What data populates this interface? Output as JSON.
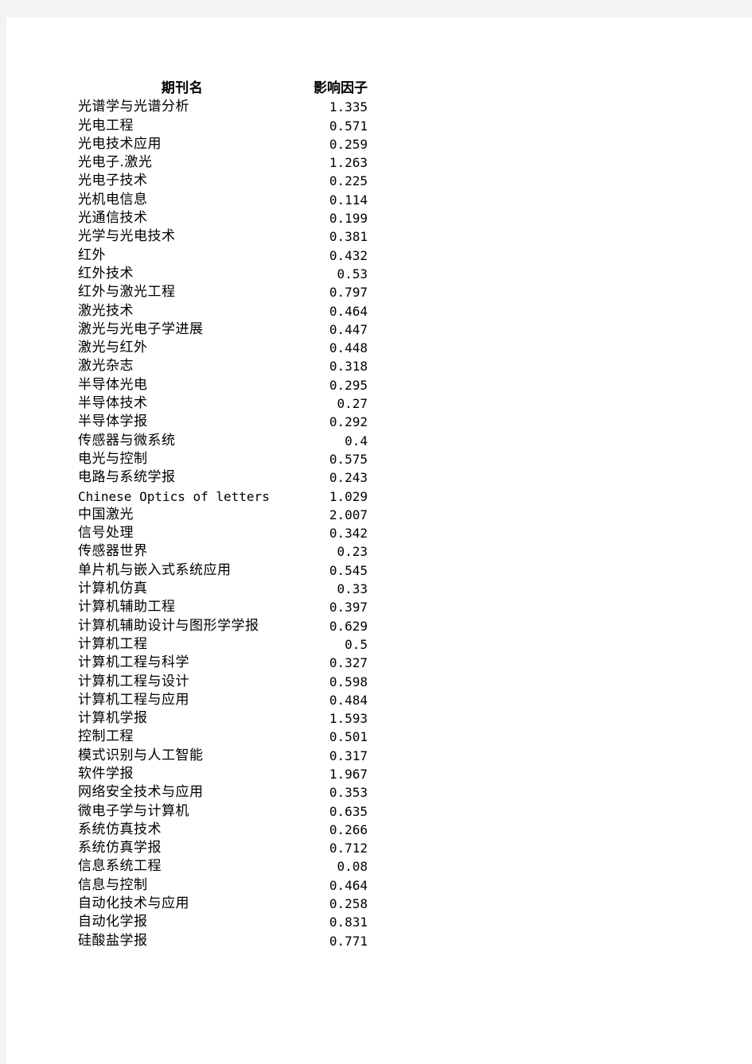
{
  "table": {
    "headers": {
      "name": "期刊名",
      "impact_factor": "影响因子"
    },
    "rows": [
      {
        "name": "光谱学与光谱分析",
        "value": "1.335"
      },
      {
        "name": "光电工程",
        "value": "0.571"
      },
      {
        "name": "光电技术应用",
        "value": "0.259"
      },
      {
        "name": "光电子.激光",
        "value": "1.263"
      },
      {
        "name": "光电子技术",
        "value": "0.225"
      },
      {
        "name": "光机电信息",
        "value": "0.114"
      },
      {
        "name": "光通信技术",
        "value": "0.199"
      },
      {
        "name": "光学与光电技术",
        "value": "0.381"
      },
      {
        "name": "红外",
        "value": "0.432"
      },
      {
        "name": "红外技术",
        "value": "0.53"
      },
      {
        "name": "红外与激光工程",
        "value": "0.797"
      },
      {
        "name": "激光技术",
        "value": "0.464"
      },
      {
        "name": "激光与光电子学进展",
        "value": "0.447"
      },
      {
        "name": "激光与红外",
        "value": "0.448"
      },
      {
        "name": "激光杂志",
        "value": "0.318"
      },
      {
        "name": "半导体光电",
        "value": "0.295"
      },
      {
        "name": "半导体技术",
        "value": "0.27"
      },
      {
        "name": "半导体学报",
        "value": "0.292"
      },
      {
        "name": "传感器与微系统",
        "value": "0.4"
      },
      {
        "name": "电光与控制",
        "value": "0.575"
      },
      {
        "name": "电路与系统学报",
        "value": "0.243"
      },
      {
        "name": "Chinese Optics of letters",
        "value": "1.029"
      },
      {
        "name": "中国激光",
        "value": "2.007"
      },
      {
        "name": "信号处理",
        "value": "0.342"
      },
      {
        "name": "传感器世界",
        "value": "0.23"
      },
      {
        "name": "单片机与嵌入式系统应用",
        "value": "0.545"
      },
      {
        "name": "计算机仿真",
        "value": "0.33"
      },
      {
        "name": "计算机辅助工程",
        "value": "0.397"
      },
      {
        "name": "计算机辅助设计与图形学学报",
        "value": "0.629"
      },
      {
        "name": "计算机工程",
        "value": "0.5"
      },
      {
        "name": "计算机工程与科学",
        "value": "0.327"
      },
      {
        "name": "计算机工程与设计",
        "value": "0.598"
      },
      {
        "name": "计算机工程与应用",
        "value": "0.484"
      },
      {
        "name": "计算机学报",
        "value": "1.593"
      },
      {
        "name": "控制工程",
        "value": "0.501"
      },
      {
        "name": "模式识别与人工智能",
        "value": "0.317"
      },
      {
        "name": "软件学报",
        "value": "1.967"
      },
      {
        "name": "网络安全技术与应用",
        "value": "0.353"
      },
      {
        "name": "微电子学与计算机",
        "value": "0.635"
      },
      {
        "name": "系统仿真技术",
        "value": "0.266"
      },
      {
        "name": "系统仿真学报",
        "value": "0.712"
      },
      {
        "name": "信息系统工程",
        "value": "0.08"
      },
      {
        "name": "信息与控制",
        "value": "0.464"
      },
      {
        "name": "自动化技术与应用",
        "value": "0.258"
      },
      {
        "name": "自动化学报",
        "value": "0.831"
      },
      {
        "name": "硅酸盐学报",
        "value": "0.771"
      }
    ]
  }
}
